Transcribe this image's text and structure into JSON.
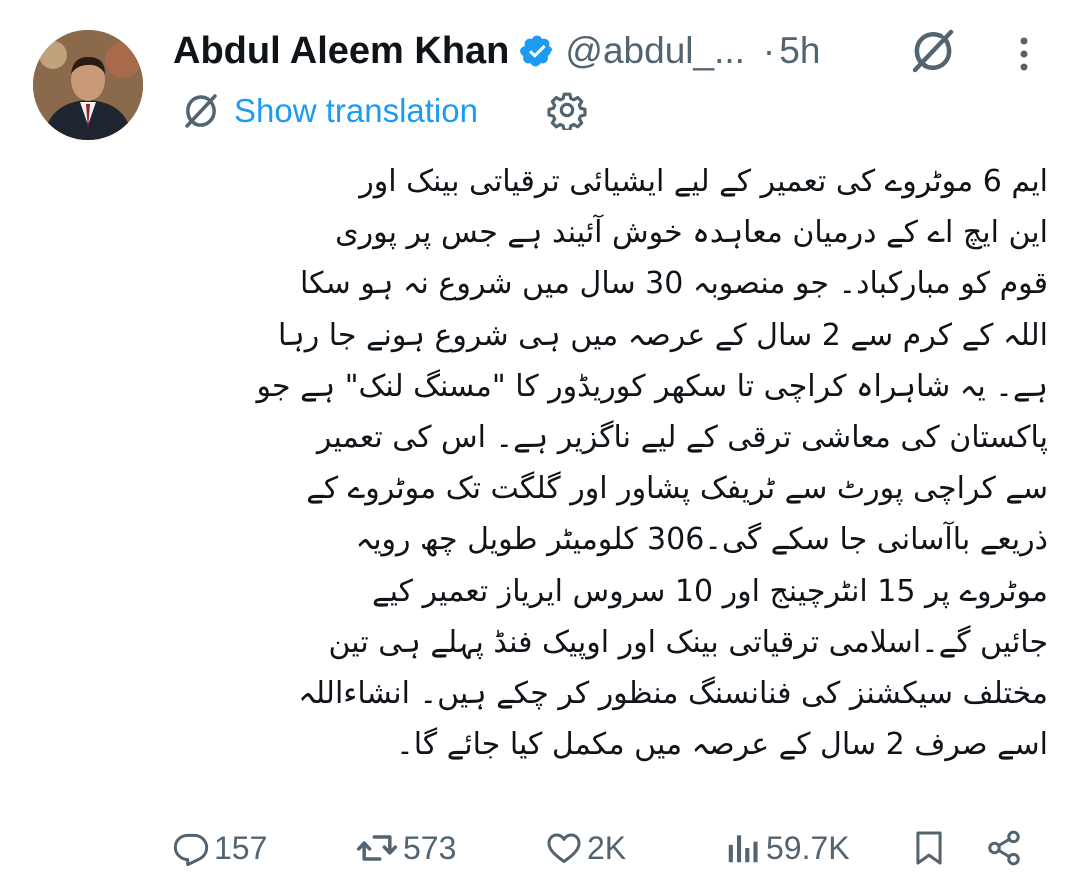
{
  "author": {
    "name": "Abdul Aleem Khan",
    "handle": "@abdul_...",
    "separator": "·",
    "time": "5h"
  },
  "translate": {
    "label": "Show translation"
  },
  "icons": {
    "avatar": "avatar",
    "verified": "verified-badge-icon",
    "grok": "grok-icon",
    "more": "more-vertical-icon",
    "translate": "translate-icon",
    "settings": "gear-icon",
    "reply": "reply-icon",
    "repost": "repost-icon",
    "like": "heart-icon",
    "views": "views-icon",
    "bookmark": "bookmark-icon",
    "share": "share-icon"
  },
  "colors": {
    "accent": "#1d9bf0",
    "muted": "#536471",
    "text": "#0f1419"
  },
  "tweet": {
    "lines": [
      "ایم 6 موٹروے کی تعمیر کے لیے ایشیائی ترقیاتی بینک اور",
      "این ایچ اے کے درمیان معاہدہ خوش آئیند ہے جس پر پوری",
      "قوم کو مبارکباد۔ جو منصوبہ 30 سال میں شروع نہ ہو سکا",
      "اللہ کے کرم سے 2 سال کے عرصہ میں ہی شروع ہونے جا رہا",
      "ہے۔ یہ شاہراہ کراچی تا سکھر کوریڈور کا \"مسنگ لنک\" ہے جو",
      "پاکستان کی معاشی ترقی کے لیے ناگزیر ہے۔ اس کی تعمیر",
      "سے کراچی پورٹ سے ٹریفک پشاور اور گلگت تک موٹروے کے",
      "ذریعے باآسانی جا سکے گی۔306 کلومیٹر طویل چھ رویہ",
      "موٹروے پر 15 انٹرچینج اور 10 سروس ایریاز تعمیر کیے",
      "جائیں گے۔اسلامی ترقیاتی بینک اور اوپیک فنڈ پہلے ہی تین",
      "مختلف سیکشنز کی فنانسنگ منظور کر چکے ہیں۔ انشاءاللہ",
      "اسے صرف 2 سال کے عرصہ میں مکمل کیا جائے گا۔"
    ]
  },
  "actions": {
    "replies": "157",
    "reposts": "573",
    "likes": "2K",
    "views": "59.7K"
  }
}
